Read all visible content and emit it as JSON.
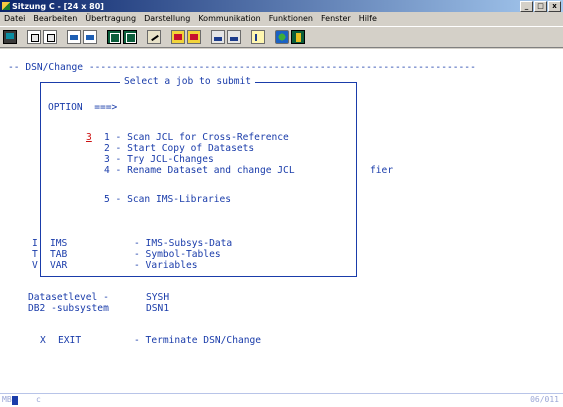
{
  "window": {
    "title": "Sitzung C - [24 x 80]"
  },
  "menu": [
    "Datei",
    "Bearbeiten",
    "Übertragung",
    "Darstellung",
    "Kommunikation",
    "Funktionen",
    "Fenster",
    "Hilfe"
  ],
  "toolbar_icons": [
    "monitor-icon",
    "copy-icon",
    "paste-icon",
    "send-icon",
    "receive-icon",
    "screen-icon",
    "screen2-icon",
    "pen-icon",
    "columns-icon",
    "tape-icon",
    "transfer-icon",
    "disk-icon",
    "note-icon",
    "globe-icon",
    "book-icon"
  ],
  "terminal": {
    "header": "-- DSN/Change -------------------------------------------------------------------",
    "panel_title": "Select a job to submit",
    "option_label": "OPTION  ===>",
    "selected_value": "3",
    "options": [
      "1 - Scan JCL for Cross-Reference",
      "2 - Start Copy of Datasets",
      "3 - Try JCL-Changes",
      "4 - Rename Dataset and change JCL",
      "5 - Scan IMS-Libraries"
    ],
    "fier_text": "fier",
    "commands": [
      {
        "key": "I",
        "name": "IMS",
        "desc": "- IMS-Subsys-Data"
      },
      {
        "key": "T",
        "name": "TAB",
        "desc": "- Symbol-Tables"
      },
      {
        "key": "V",
        "name": "VAR",
        "desc": "- Variables"
      }
    ],
    "datasetlevel_label": "Datasetlevel -",
    "datasetlevel_value": "SYSH",
    "db2_label": "DB2 -subsystem",
    "db2_value": "DSN1",
    "exit": {
      "key": "X",
      "name": "EXIT",
      "desc": "- Terminate DSN/Change"
    }
  },
  "status": {
    "left": "MB",
    "mode": "c",
    "position": "06/011"
  }
}
